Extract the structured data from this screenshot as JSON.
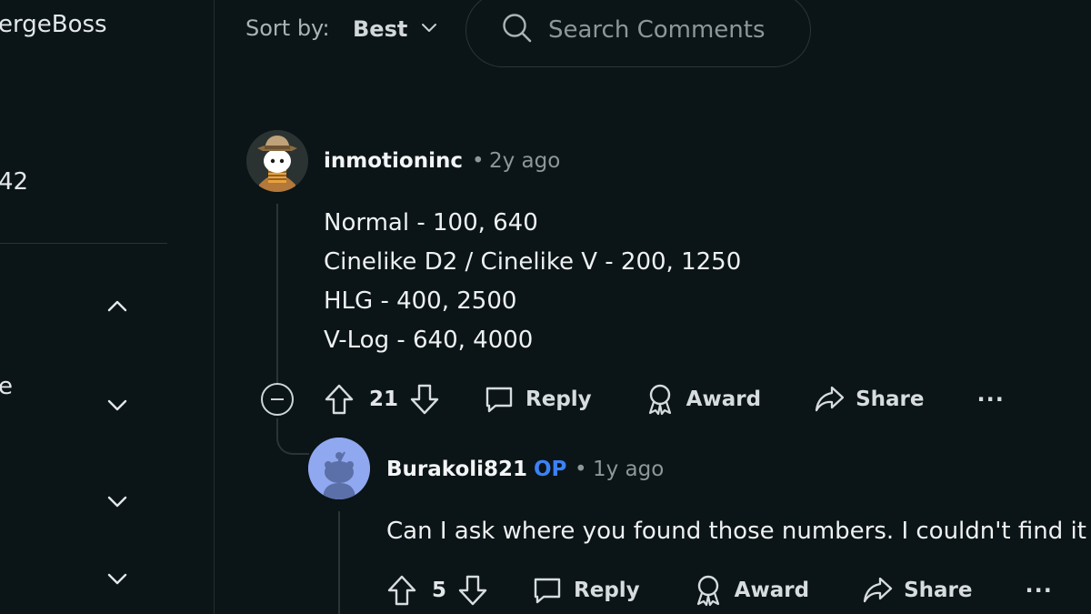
{
  "sidebar": {
    "title_fragment": "ergeBoss",
    "number_fragment": "42",
    "row_fragment": "e"
  },
  "sort": {
    "label": "Sort by:",
    "value": "Best"
  },
  "search": {
    "placeholder": "Search Comments"
  },
  "comments": [
    {
      "author": "inmotioninc",
      "separator": "•",
      "time": "2y ago",
      "body": [
        "Normal - 100, 640",
        "Cinelike D2 / Cinelike V - 200, 1250",
        "HLG - 400, 2500",
        "V-Log - 640, 4000"
      ],
      "votes": "21",
      "actions": {
        "reply": "Reply",
        "award": "Award",
        "share": "Share",
        "more": "···"
      }
    },
    {
      "author": "Burakoli821",
      "badge": "OP",
      "separator": "•",
      "time": "1y ago",
      "body": [
        "Can I ask where you found those numbers. I couldn't find it"
      ],
      "votes": "5",
      "actions": {
        "reply": "Reply",
        "award": "Award",
        "share": "Share",
        "more": "···"
      }
    }
  ],
  "colors": {
    "background": "#0b1416",
    "op_badge": "#3b82f6",
    "avatar2_bg": "#8fa8f0"
  },
  "icons": [
    "search-icon",
    "chevron-down-icon",
    "chevron-up-icon",
    "upvote-icon",
    "downvote-icon",
    "comment-icon",
    "award-icon",
    "share-icon",
    "collapse-icon"
  ]
}
